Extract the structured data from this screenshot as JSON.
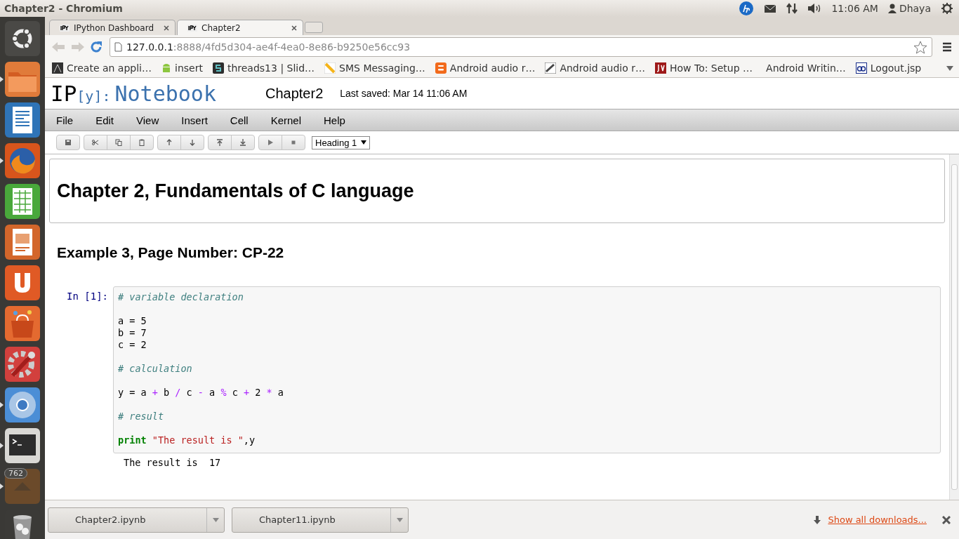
{
  "top_panel": {
    "title": "Chapter2 - Chromium",
    "clock": "11:06 AM",
    "user": "Dhaya"
  },
  "launcher": [
    {
      "kind": "ubuntu",
      "running": false
    },
    {
      "kind": "folder",
      "running": true
    },
    {
      "kind": "writer",
      "running": false
    },
    {
      "kind": "firefox",
      "running": true
    },
    {
      "kind": "calc",
      "running": false
    },
    {
      "kind": "impress",
      "running": false
    },
    {
      "kind": "ubuntuone",
      "running": false
    },
    {
      "kind": "store",
      "running": false
    },
    {
      "kind": "settings",
      "running": false
    },
    {
      "kind": "chromium",
      "running": true
    },
    {
      "kind": "terminal",
      "running": true
    },
    {
      "kind": "updates",
      "running": true,
      "badge": "762"
    },
    {
      "kind": "trash",
      "running": false
    }
  ],
  "tabs": [
    {
      "label": "IPython Dashboard",
      "selected": false
    },
    {
      "label": "Chapter2",
      "selected": true
    }
  ],
  "address": {
    "host": "127.0.0.1",
    "path": ":8888/4fd5d304-ae4f-4ea0-8e86-b9250e56cc93"
  },
  "bookmarks": [
    {
      "kind": "page",
      "label": "Create an appli…"
    },
    {
      "kind": "android",
      "label": "insert"
    },
    {
      "kind": "slides",
      "label": "threads13 | Slid…"
    },
    {
      "kind": "stripe",
      "label": "SMS Messaging…"
    },
    {
      "kind": "blogger",
      "label": "Android audio r…"
    },
    {
      "kind": "adb",
      "label": "Android audio r…"
    },
    {
      "kind": "jv",
      "label": "How To: Setup …"
    },
    {
      "kind": "none",
      "label": "Android Writin…"
    },
    {
      "kind": "link",
      "label": "Logout.jsp"
    }
  ],
  "notebook": {
    "logo_ip": "IP",
    "logo_bracket": "[y]:",
    "logo_word": "Notebook",
    "name": "Chapter2",
    "last_saved": "Last saved: Mar 14 11:06 AM",
    "menu": [
      "File",
      "Edit",
      "View",
      "Insert",
      "Cell",
      "Kernel",
      "Help"
    ],
    "toolbar_groups": [
      [
        {
          "kind": "save"
        }
      ],
      [
        {
          "kind": "cut"
        },
        {
          "kind": "copy"
        },
        {
          "kind": "paste"
        }
      ],
      [
        {
          "kind": "up"
        },
        {
          "kind": "down"
        }
      ],
      [
        {
          "kind": "insert-above"
        },
        {
          "kind": "insert-below"
        }
      ],
      [
        {
          "kind": "run"
        },
        {
          "kind": "stop"
        }
      ]
    ],
    "cell_type": "Heading 1",
    "heading1": "Chapter 2, Fundamentals of C language",
    "heading3": "Example 3, Page Number: CP-22",
    "prompt": "In [1]:",
    "code": [
      {
        "kind": "code",
        "tokens": [
          {
            "t": "# variable declaration",
            "kind": "comment"
          }
        ]
      },
      {
        "kind": "blank"
      },
      {
        "kind": "code",
        "tokens": [
          {
            "t": "a = 5",
            "kind": "plain"
          }
        ]
      },
      {
        "kind": "code",
        "tokens": [
          {
            "t": "b = 7",
            "kind": "plain"
          }
        ]
      },
      {
        "kind": "code",
        "tokens": [
          {
            "t": "c = 2",
            "kind": "plain"
          }
        ]
      },
      {
        "kind": "blank"
      },
      {
        "kind": "code",
        "tokens": [
          {
            "t": "# calculation",
            "kind": "comment"
          }
        ]
      },
      {
        "kind": "blank"
      },
      {
        "kind": "code",
        "tokens": [
          {
            "t": "y = a ",
            "kind": "plain"
          },
          {
            "t": "+",
            "kind": "op"
          },
          {
            "t": " b ",
            "kind": "plain"
          },
          {
            "t": "/",
            "kind": "op"
          },
          {
            "t": " c ",
            "kind": "plain"
          },
          {
            "t": "-",
            "kind": "op"
          },
          {
            "t": " a ",
            "kind": "plain"
          },
          {
            "t": "%",
            "kind": "op"
          },
          {
            "t": " c ",
            "kind": "plain"
          },
          {
            "t": "+",
            "kind": "op"
          },
          {
            "t": " 2 ",
            "kind": "plain"
          },
          {
            "t": "*",
            "kind": "op"
          },
          {
            "t": " a",
            "kind": "plain"
          }
        ]
      },
      {
        "kind": "blank"
      },
      {
        "kind": "code",
        "tokens": [
          {
            "t": "# result",
            "kind": "comment"
          }
        ]
      },
      {
        "kind": "blank"
      },
      {
        "kind": "code",
        "tokens": [
          {
            "t": "print",
            "kind": "keyword"
          },
          {
            "t": " \"The result is \"",
            "kind": "string"
          },
          {
            "t": ",y",
            "kind": "plain"
          }
        ]
      }
    ],
    "output": "The result is  17"
  },
  "downloads": {
    "items": [
      "Chapter2.ipynb",
      "Chapter11.ipynb"
    ],
    "show_all": "Show all downloads..."
  }
}
